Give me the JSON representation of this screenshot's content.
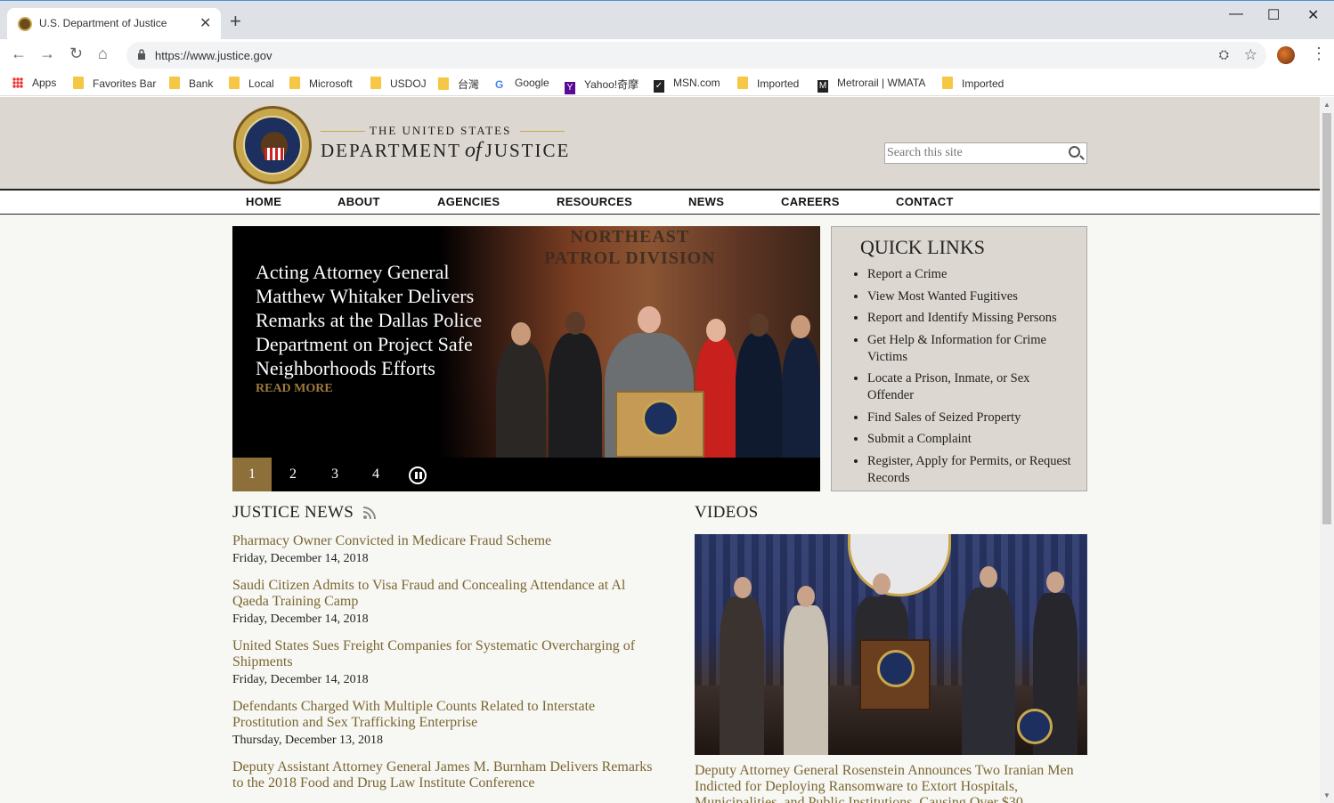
{
  "browser": {
    "tab_title": "U.S. Department of Justice",
    "tab_close": "✕",
    "new_tab": "+",
    "url": "https://www.justice.gov",
    "win_min": "—",
    "win_max": "☐",
    "win_close": "✕",
    "bookmarks": [
      "Apps",
      "Favorites Bar",
      "Bank",
      "Local",
      "Microsoft",
      "USDOJ",
      "台灣",
      "Google",
      "Yahoo!奇摩",
      "MSN.com",
      "Imported",
      "Metrorail | WMATA",
      "Imported"
    ]
  },
  "site": {
    "org_top": "THE UNITED STATES",
    "org_dept": "DEPARTMENT",
    "org_of": "of",
    "org_justice": "JUSTICE",
    "search_placeholder": "Search this site",
    "nav": [
      "HOME",
      "ABOUT",
      "AGENCIES",
      "RESOURCES",
      "NEWS",
      "CAREERS",
      "CONTACT"
    ]
  },
  "hero": {
    "headline": "Acting Attorney General Matthew Whitaker Delivers Remarks at the Dallas Police Department on Project Safe Neighborhoods Efforts",
    "read_more": "READ MORE",
    "sign_line1": "NORTHEAST",
    "sign_line2": "PATROL DIVISION",
    "pages": [
      "1",
      "2",
      "3",
      "4"
    ],
    "active_page": 1
  },
  "quick_links": {
    "title": "QUICK LINKS",
    "items": [
      "Report a Crime",
      "View Most Wanted Fugitives",
      "Report and Identify Missing Persons",
      "Get Help & Information for Crime Victims",
      "Locate a Prison, Inmate, or Sex Offender",
      "Find Sales of Seized Property",
      "Submit a Complaint",
      "Register, Apply for Permits, or Request Records"
    ]
  },
  "news": {
    "title": "JUSTICE NEWS",
    "items": [
      {
        "headline": "Pharmacy Owner Convicted in Medicare Fraud Scheme",
        "date": "Friday, December 14, 2018"
      },
      {
        "headline": "Saudi Citizen Admits to Visa Fraud and Concealing Attendance at Al Qaeda Training Camp",
        "date": "Friday, December 14, 2018"
      },
      {
        "headline": "United States Sues Freight Companies for Systematic Overcharging of Shipments",
        "date": "Friday, December 14, 2018"
      },
      {
        "headline": "Defendants Charged With Multiple Counts Related to Interstate Prostitution and Sex Trafficking Enterprise",
        "date": "Thursday, December 13, 2018"
      },
      {
        "headline": "Deputy Assistant Attorney General James M. Burnham Delivers Remarks to the 2018 Food and Drug Law Institute Conference",
        "date": ""
      }
    ]
  },
  "videos": {
    "title": "VIDEOS",
    "caption": "Deputy Attorney General Rosenstein Announces Two Iranian Men Indicted for Deploying Ransomware to Extort Hospitals, Municipalities, and Public Institutions, Causing Over $30"
  },
  "colors": {
    "accent_gold": "#8d6f3a",
    "link_gold": "#7a6630",
    "header_bg": "#dcd7d0",
    "page_bg": "#f7f7f4"
  }
}
